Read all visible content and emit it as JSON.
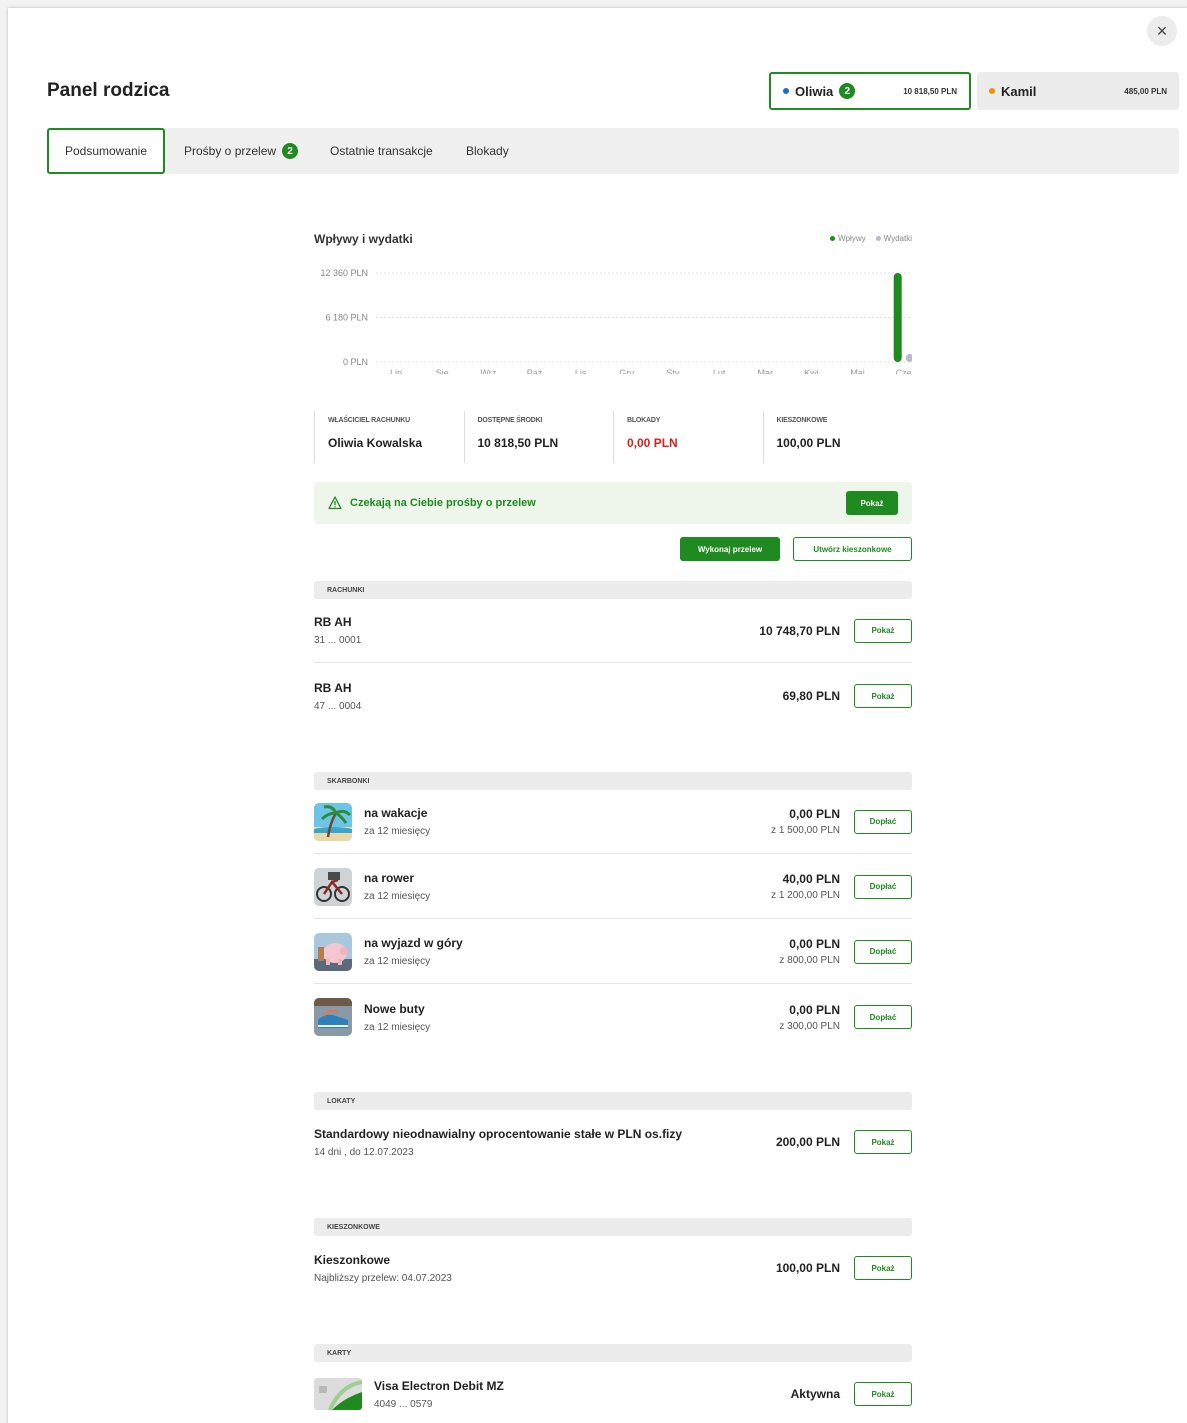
{
  "header": {
    "title": "Panel rodzica",
    "close_icon": "×"
  },
  "children": [
    {
      "name": "Oliwia",
      "badge": "2",
      "amount": "10 818,50 PLN",
      "dot_color": "#1a6fd1"
    },
    {
      "name": "Kamil",
      "amount": "485,00 PLN",
      "dot_color": "#f39200"
    }
  ],
  "tabs": [
    {
      "label": "Podsumowanie"
    },
    {
      "label": "Prośby o przelew",
      "badge": "2"
    },
    {
      "label": "Ostatnie transakcje"
    },
    {
      "label": "Blokady"
    }
  ],
  "chart": {
    "title": "Wpływy i wydatki",
    "legend": [
      {
        "label": "Wpływy",
        "color": "#1f8a1f"
      },
      {
        "label": "Wydatki",
        "color": "#b9bcc6"
      }
    ]
  },
  "chart_data": {
    "type": "bar",
    "title": "Wpływy i wydatki",
    "categories": [
      "Lip",
      "Sie",
      "Wrz",
      "Paź",
      "Lis",
      "Gru",
      "Sty",
      "Lut",
      "Mar",
      "Kwi",
      "Maj",
      "Cze"
    ],
    "series": [
      {
        "name": "Wpływy",
        "values": [
          0,
          0,
          0,
          0,
          0,
          0,
          0,
          0,
          0,
          0,
          0,
          12360
        ],
        "color": "#1f8a1f"
      },
      {
        "name": "Wydatki",
        "values": [
          0,
          0,
          0,
          0,
          0,
          0,
          0,
          0,
          0,
          0,
          0,
          90
        ],
        "color": "#b9bcc6"
      }
    ],
    "y_ticks": [
      "12 360 PLN",
      "6 180 PLN",
      "0 PLN"
    ],
    "y_tick_values": [
      12360,
      6180,
      0
    ],
    "ylim": [
      0,
      12360
    ],
    "grid": true,
    "legend_position": "top-right"
  },
  "info": [
    {
      "label": "WŁAŚCICIEL RACHUNKU",
      "value": "Oliwia Kowalska",
      "color": "#222222"
    },
    {
      "label": "DOSTĘPNE ŚRODKI",
      "value": "10 818,50 PLN",
      "color": "#222222"
    },
    {
      "label": "BLOKADY",
      "value": "0,00 PLN",
      "color": "#d32020"
    },
    {
      "label": "KIESZONKOWE",
      "value": "100,00 PLN",
      "color": "#222222"
    }
  ],
  "alert": {
    "text": "Czekają na Ciebie prośby o przelew",
    "button": "Pokaż"
  },
  "actions": {
    "transfer": "Wykonaj przelew",
    "create_allowance": "Utwórz kieszonkowe"
  },
  "sections": {
    "accounts": {
      "header": "RACHUNKI",
      "items": [
        {
          "title": "RB AH",
          "sub": "31 ... 0001",
          "amount": "10 748,70 PLN",
          "button": "Pokaż"
        },
        {
          "title": "RB AH",
          "sub": "47 ... 0004",
          "amount": "69,80 PLN",
          "button": "Pokaż"
        }
      ]
    },
    "piggybanks": {
      "header": "SKARBONKI",
      "items": [
        {
          "title": "na wakacje",
          "sub": "za 12 miesięcy",
          "amount": "0,00 PLN",
          "goal": "z 1 500,00 PLN",
          "button": "Dopłać"
        },
        {
          "title": "na rower",
          "sub": "za 12 miesięcy",
          "amount": "40,00 PLN",
          "goal": "z 1 200,00 PLN",
          "button": "Dopłać"
        },
        {
          "title": "na wyjazd w góry",
          "sub": "za 12 miesięcy",
          "amount": "0,00 PLN",
          "goal": "z 800,00 PLN",
          "button": "Dopłać"
        },
        {
          "title": "Nowe buty",
          "sub": "za 12 miesięcy",
          "amount": "0,00 PLN",
          "goal": "z 300,00 PLN",
          "button": "Dopłać"
        }
      ]
    },
    "deposits": {
      "header": "LOKATY",
      "items": [
        {
          "title": "Standardowy nieodnawialny oprocentowanie stałe w PLN os.fizy",
          "sub": "14 dni , do 12.07.2023",
          "amount": "200,00 PLN",
          "button": "Pokaż"
        }
      ]
    },
    "allowance": {
      "header": "KIESZONKOWE",
      "items": [
        {
          "title": "Kieszonkowe",
          "sub": "Najbliższy przelew: 04.07.2023",
          "amount": "100,00 PLN",
          "button": "Pokaż"
        }
      ]
    },
    "cards": {
      "header": "KARTY",
      "items": [
        {
          "title": "Visa Electron Debit MZ",
          "sub": "4049 ... 0579",
          "status": "Aktywna",
          "button": "Pokaż"
        }
      ]
    }
  }
}
